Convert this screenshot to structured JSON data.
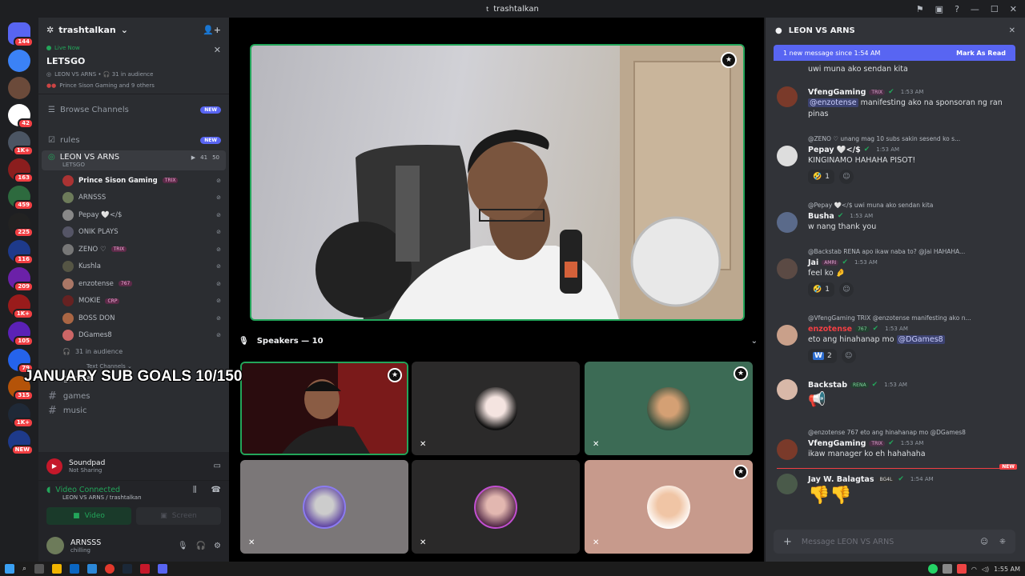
{
  "window": {
    "title": "trashtalkan"
  },
  "servers": [
    {
      "badge": "144",
      "color": "#5865f2"
    },
    {
      "badge": "",
      "color": "#3b82f6"
    },
    {
      "badge": "",
      "color": "#6b4a3a"
    },
    {
      "badge": "42",
      "color": "#ffffff"
    },
    {
      "badge": "1K+",
      "color": "#4b5563"
    },
    {
      "badge": "163",
      "color": "#8b1e1e"
    },
    {
      "badge": "459",
      "color": "#2d6a3e"
    },
    {
      "badge": "225",
      "color": "#222"
    },
    {
      "badge": "116",
      "color": "#1e3a8a"
    },
    {
      "badge": "209",
      "color": "#6b21a8"
    },
    {
      "badge": "1K+",
      "color": "#991b1b"
    },
    {
      "badge": "105",
      "color": "#5b21b6"
    },
    {
      "badge": "79",
      "color": "#2563eb"
    },
    {
      "badge": "315",
      "color": "#b45309"
    },
    {
      "badge": "1K+",
      "color": "#1f2937"
    },
    {
      "badge": "NEW",
      "color": "#1e3a8a"
    }
  ],
  "guild": {
    "name": "trashtalkan",
    "live": {
      "label": "Live Now",
      "title": "LETSGO",
      "meta": "LEON VS ARNS • 🎧 31 in audience",
      "others": "Prince Sison Gaming and 9 others"
    },
    "browse": {
      "label": "Browse Channels",
      "badge": "NEW"
    },
    "rules": {
      "label": "rules",
      "badge": "NEW"
    },
    "voice": {
      "name": "LEON VS ARNS",
      "sub": "LETSGO",
      "count_a": "41",
      "count_b": "50",
      "members": [
        {
          "name": "Prince Sison Gaming",
          "tag": "TRIX",
          "color": "#a33",
          "bold": true
        },
        {
          "name": "ARNSSS",
          "tag": "",
          "color": "#6d7b5a"
        },
        {
          "name": "Pepay 🤍</$",
          "tag": "",
          "color": "#888"
        },
        {
          "name": "ONIK PLAYS",
          "tag": "",
          "color": "#556"
        },
        {
          "name": "ZENO ♡",
          "tag": "TRIX",
          "color": "#777"
        },
        {
          "name": "Kushla",
          "tag": "",
          "color": "#554"
        },
        {
          "name": "enzotense",
          "tag": "767",
          "color": "#a76"
        },
        {
          "name": "MOKIE",
          "tag": "CRP",
          "color": "#622"
        },
        {
          "name": "BOSS DON",
          "tag": "",
          "color": "#a64"
        },
        {
          "name": "DGames8",
          "tag": "",
          "color": "#c66"
        }
      ],
      "audience": "31 in audience"
    },
    "overlay": "JANUARY SUB GOALS 10/150",
    "text_category": "Text Channels",
    "text_channels": [
      "general",
      "games",
      "music"
    ]
  },
  "panel": {
    "soundpad": {
      "title": "Soundpad",
      "sub": "Not Sharing"
    },
    "voice": {
      "status": "Video Connected",
      "sub": "LEON VS ARNS / trashtalkan",
      "video": "Video",
      "screen": "Screen"
    },
    "user": {
      "name": "ARNSSS",
      "status": "chilling"
    }
  },
  "stage": {
    "speakers": "Speakers — 10"
  },
  "chat": {
    "title": "LEON VS ARNS",
    "banner": "1 new message since 1:54 AM",
    "mark_read": "Mark As Read",
    "placeholder": "Message LEON VS ARNS",
    "new_label": "NEW",
    "messages": {
      "m0": {
        "text": "uwi muna ako sendan kita"
      },
      "m1": {
        "name": "VfengGaming",
        "tag": "TRIX",
        "time": "1:53 AM",
        "mention": "@enzotense",
        "text": " manifesting ako na sponsoran ng ran pinas"
      },
      "m2": {
        "reply": "@ZENO ♡  unang mag 10 subs sakin sesend ko s...",
        "name": "Pepay 🤍</$",
        "time": "1:53 AM",
        "text": "KINGINAMO HAHAHA PISOT!",
        "react": "1"
      },
      "m3": {
        "reply": "@Pepay 🤍</$  uwi muna ako sendan kita",
        "name": "Busha",
        "time": "1:53 AM",
        "text": "w nang thank you"
      },
      "m4": {
        "reply": "@Backstab RENA  apo ikaw naba to? @Jai HAHAHA...",
        "name": "Jai",
        "tag": "AMRI",
        "time": "1:53 AM",
        "text": "feel ko",
        "react": "1"
      },
      "m5": {
        "reply": "@VfengGaming TRIX @enzotense manifesting ako n...",
        "name": "enzotense",
        "tag": "767",
        "time": "1:53 AM",
        "text": "eto ang hinahanap mo ",
        "mention": "@DGames8",
        "react": "2"
      },
      "m6": {
        "name": "Backstab",
        "tag": "RENA",
        "time": "1:53 AM",
        "text": "📢"
      },
      "m7": {
        "reply": "@enzotense 767 eto ang hinahanap mo @DGames8",
        "name": "VfengGaming",
        "tag": "TRIX",
        "time": "1:53 AM",
        "text": "ikaw manager ko eh hahahaha"
      },
      "m8": {
        "name": "Jay W. Balagtas",
        "tag": "BG4L",
        "time": "1:54 AM",
        "text": "👎👎"
      }
    }
  },
  "taskbar": {
    "time": "1:55 AM"
  }
}
